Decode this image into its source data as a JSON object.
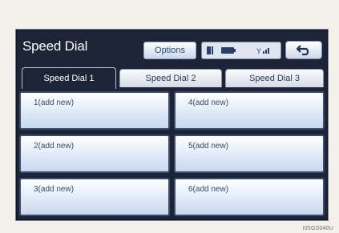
{
  "header": {
    "title": "Speed Dial",
    "options_label": "Options",
    "status_icons": [
      "bluetooth-icon",
      "battery-icon",
      "signal-icon"
    ],
    "back_icon": "return-arrow-icon"
  },
  "tabs": [
    {
      "label": "Speed Dial 1",
      "selected": true
    },
    {
      "label": "Speed Dial 2",
      "selected": false
    },
    {
      "label": "Speed Dial 3",
      "selected": false
    }
  ],
  "cells": [
    {
      "label": "1(add new)"
    },
    {
      "label": "4(add new)"
    },
    {
      "label": "2(add new)"
    },
    {
      "label": "5(add new)"
    },
    {
      "label": "3(add new)"
    },
    {
      "label": "6(add new)"
    }
  ],
  "image_code": "I05GS040U",
  "colors": {
    "screen_bg": "#1d2437",
    "button_text": "#2b4a7c",
    "cell_gradient_top": "#ffffff",
    "cell_gradient_bottom": "#c8d8ef"
  }
}
